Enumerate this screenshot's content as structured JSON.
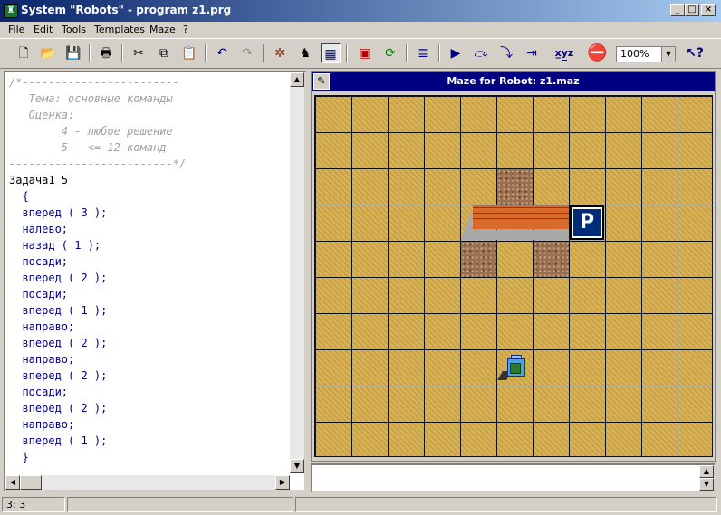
{
  "window": {
    "title": "System \"Robots\" - program z1.prg",
    "app_icon": "castle-icon",
    "controls": [
      "minimize-icon",
      "maximize-icon",
      "close-icon"
    ]
  },
  "menu": {
    "file": "File",
    "edit": "Edit",
    "tools": "Tools",
    "templates": "Templates",
    "maze": "Maze",
    "help": "?"
  },
  "toolbar": {
    "icons": [
      "new-file-icon",
      "open-folder-icon",
      "save-icon",
      "print-icon",
      "cut-icon",
      "copy-icon",
      "paste-icon",
      "undo-icon",
      "redo-icon",
      "bug-icon",
      "robot-icon",
      "maze-view-icon",
      "maze-edit-icon",
      "refresh-icon",
      "align-icon",
      "run-icon",
      "step-over-icon",
      "step-into-icon",
      "run-to-cursor-icon",
      "variables-icon",
      "stop-icon",
      "help-cursor-icon"
    ],
    "zoom": "100%"
  },
  "editor": {
    "comment_lines": [
      "/*------------------------",
      "   Тема: основные команды",
      "   Оценка:",
      "        4 - любое решение",
      "        5 - <= 12 команд",
      "-------------------------*/"
    ],
    "program_name": "Задача1_5",
    "code_lines": [
      "  {",
      "  вперед ( 3 );",
      "  налево;",
      "  назад ( 1 );",
      "  посади;",
      "  вперед ( 2 );",
      "  посади;",
      "  вперед ( 1 );",
      "  направо;",
      "  вперед ( 2 );",
      "  направо;",
      "  вперед ( 2 );",
      "  посади;",
      "  вперед ( 2 );",
      "  направо;",
      "  вперед ( 1 );",
      "  }"
    ]
  },
  "maze": {
    "title": "Maze for Robot: z1.maz",
    "parking_label": "P",
    "columns": 11,
    "rows": 10,
    "pits": [
      {
        "col": 5,
        "row": 2
      },
      {
        "col": 4,
        "row": 4
      },
      {
        "col": 6,
        "row": 4
      }
    ],
    "wall": {
      "from_col": 4,
      "to_col": 6,
      "row": 3,
      "side": "horizontal"
    },
    "parking": {
      "col": 7,
      "row": 3
    },
    "robot": {
      "col": 5,
      "row": 7
    }
  },
  "output": {
    "text": ""
  },
  "status": {
    "position": "3: 3"
  }
}
